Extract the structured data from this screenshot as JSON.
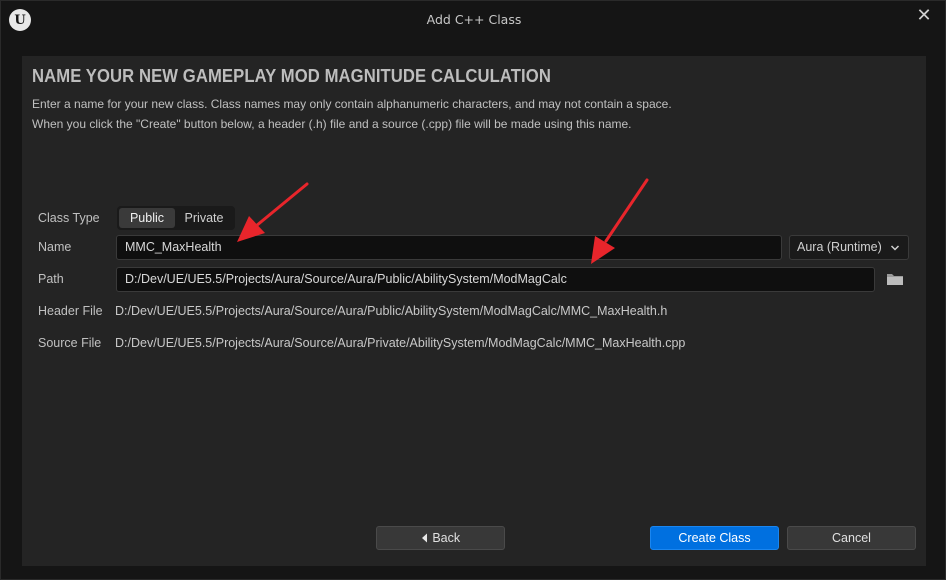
{
  "window": {
    "title": "Add C++ Class",
    "logo_glyph": "U"
  },
  "heading": "NAME YOUR NEW GAMEPLAY MOD MAGNITUDE CALCULATION",
  "description": {
    "line1": "Enter a name for your new class. Class names may only contain alphanumeric characters, and may not contain a space.",
    "line2": "When you click the \"Create\" button below, a header (.h) file and a source (.cpp) file will be made using this name."
  },
  "form": {
    "class_type_label": "Class Type",
    "class_type_options": [
      "Public",
      "Private"
    ],
    "class_type_selected": "Public",
    "name_label": "Name",
    "name_value": "MMC_MaxHealth",
    "module_value": "Aura (Runtime)",
    "path_label": "Path",
    "path_value": "D:/Dev/UE/UE5.5/Projects/Aura/Source/Aura/Public/AbilitySystem/ModMagCalc",
    "header_label": "Header File",
    "header_value": "D:/Dev/UE/UE5.5/Projects/Aura/Source/Aura/Public/AbilitySystem/ModMagCalc/MMC_MaxHealth.h",
    "source_label": "Source File",
    "source_value": "D:/Dev/UE/UE5.5/Projects/Aura/Source/Aura/Private/AbilitySystem/ModMagCalc/MMC_MaxHealth.cpp"
  },
  "buttons": {
    "back": "Back",
    "create": "Create Class",
    "cancel": "Cancel"
  },
  "icons": {
    "close": "close-icon",
    "folder": "folder-icon",
    "chevron": "chevron-down-icon",
    "back": "chevron-left-icon",
    "annotation": "arrow-annotation"
  },
  "colors": {
    "accent": "#0070e0",
    "annotation": "#e8252b",
    "panel": "#242424",
    "background": "#151515"
  }
}
